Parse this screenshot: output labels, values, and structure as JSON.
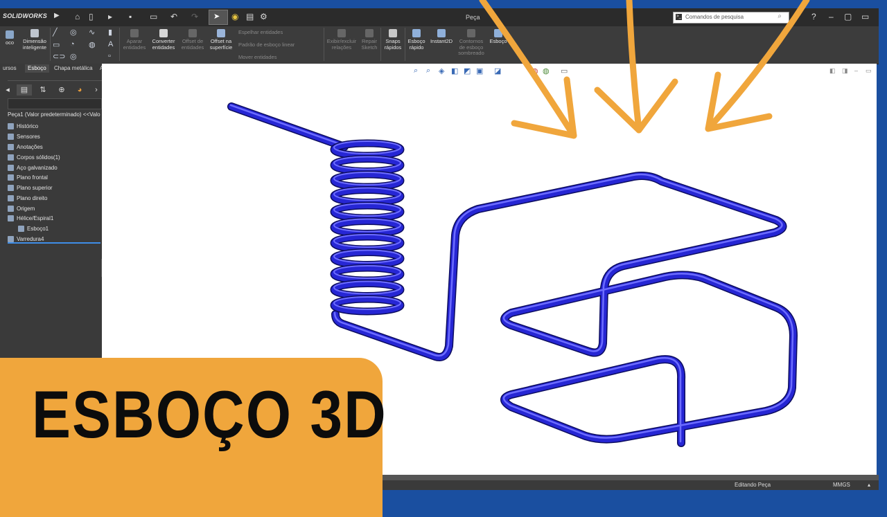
{
  "app": {
    "logo": "SOLIDWORKS",
    "document_title": "Peça",
    "search_placeholder": "Comandos de pesquisa"
  },
  "ribbon": {
    "sketch_label": "oco",
    "smart_dim_label": "Dimensão inteligente",
    "trim_label": "Aparar entidades",
    "convert_label": "Converter entidades",
    "offset_label": "Offset de entidades",
    "offset_surface_label": "Offset na superfície",
    "mirror_label": "Espelhar entidades",
    "linear_pattern_label": "Padrão de esboço linear",
    "move_label": "Mover entidades",
    "show_hide_label": "Exibir/excluir relações",
    "repair_label": "Repair Sketch",
    "snaps_label": "Snaps rápidos",
    "rapid_sketch_label": "Esboço rápido",
    "instant2d_label": "Instant2D",
    "shaded_contours_label": "Contornos de esboço sombreado",
    "sketch3d_label": "Esboço"
  },
  "tabs": [
    "ursos",
    "Esboço",
    "Chapa metálica",
    "Avaliar"
  ],
  "active_tab_index": 1,
  "tree": {
    "root": "Peça1 (Valor predeterminado) <<Valo",
    "items": [
      {
        "label": "Histórico",
        "icon": "history-icon"
      },
      {
        "label": "Sensores",
        "icon": "sensor-icon"
      },
      {
        "label": "Anotações",
        "icon": "annotation-icon"
      },
      {
        "label": "Corpos sólidos(1)",
        "icon": "solid-bodies-icon"
      },
      {
        "label": "Aço galvanizado",
        "icon": "material-icon"
      },
      {
        "label": "Plano frontal",
        "icon": "plane-icon"
      },
      {
        "label": "Plano superior",
        "icon": "plane-icon"
      },
      {
        "label": "Plano direito",
        "icon": "plane-icon"
      },
      {
        "label": "Origem",
        "icon": "origin-icon"
      },
      {
        "label": "Hélice/Espiral1",
        "icon": "helix-icon"
      },
      {
        "label": "Esboço1",
        "icon": "sketch-icon"
      },
      {
        "label": "Varredura4",
        "icon": "sweep-icon"
      }
    ]
  },
  "status": {
    "mode": "Editando Peça",
    "units": "MMGS"
  },
  "overlay": {
    "headline": "ESBOÇO 3D",
    "arrow_color": "#f0a63c",
    "banner_color": "#f0a63c",
    "frame_color": "#1a4fa0"
  },
  "model": {
    "tube_color": "#2222cc"
  }
}
